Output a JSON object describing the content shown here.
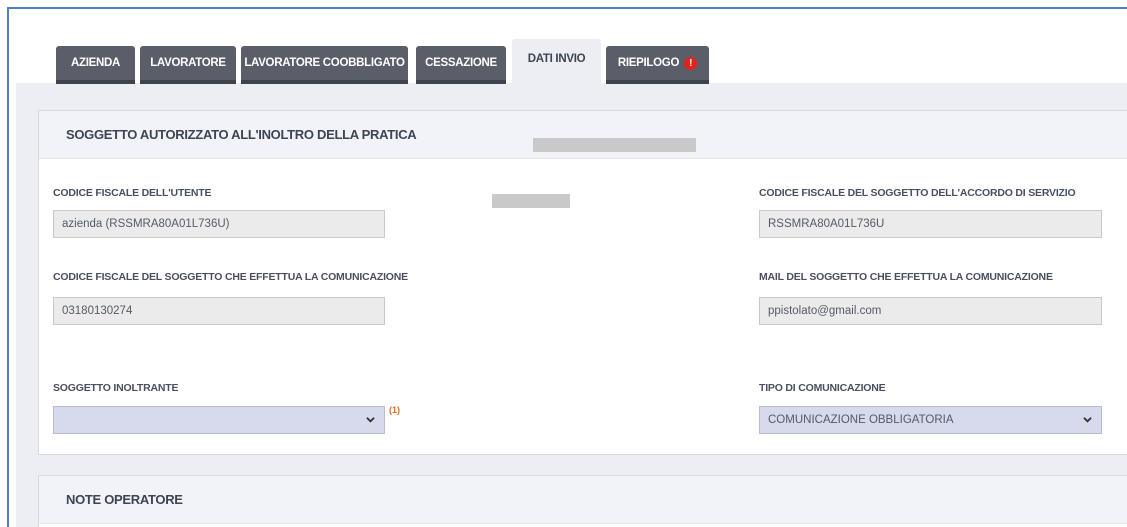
{
  "tabs": [
    {
      "label": "AZIENDA",
      "active": false
    },
    {
      "label": "LAVORATORE",
      "active": false
    },
    {
      "label": "LAVORATORE COOBBLIGATO",
      "active": false
    },
    {
      "label": "CESSAZIONE",
      "active": false
    },
    {
      "label": "DATI INVIO",
      "active": true
    },
    {
      "label": "RIEPILOGO",
      "active": false,
      "icon": "warning-icon",
      "icon_glyph": "!"
    }
  ],
  "section_soggetto": {
    "title": "SOGGETTO AUTORIZZATO ALL'INOLTRO DELLA PRATICA",
    "codice_fiscale_utente": {
      "label": "CODICE FISCALE DELL'UTENTE",
      "value": "azienda (RSSMRA80A01L736U)"
    },
    "codice_fiscale_accordo": {
      "label": "CODICE FISCALE DEL SOGGETTO DELL'ACCORDO DI SERVIZIO",
      "value": "RSSMRA80A01L736U"
    },
    "codice_fiscale_comunicazione": {
      "label": "CODICE FISCALE DEL SOGGETTO CHE EFFETTUA LA COMUNICAZIONE",
      "value": "03180130274"
    },
    "mail_comunicazione": {
      "label": "MAIL DEL SOGGETTO CHE EFFETTUA LA COMUNICAZIONE",
      "value": "ppistolato@gmail.com"
    },
    "soggetto_inoltrante": {
      "label": "SOGGETTO INOLTRANTE",
      "value": "",
      "note_ref": "(1)"
    },
    "tipo_comunicazione": {
      "label": "TIPO DI COMUNICAZIONE",
      "value": "COMUNICAZIONE OBBLIGATORIA"
    }
  },
  "section_note": {
    "title": "NOTE OPERATORE"
  },
  "colors": {
    "tab_bg": "#5a5e69",
    "tab_active_bg": "#eceef3",
    "select_bg": "#d7d9ec",
    "warning": "#e3231b",
    "note_ref": "#e06a1b"
  }
}
